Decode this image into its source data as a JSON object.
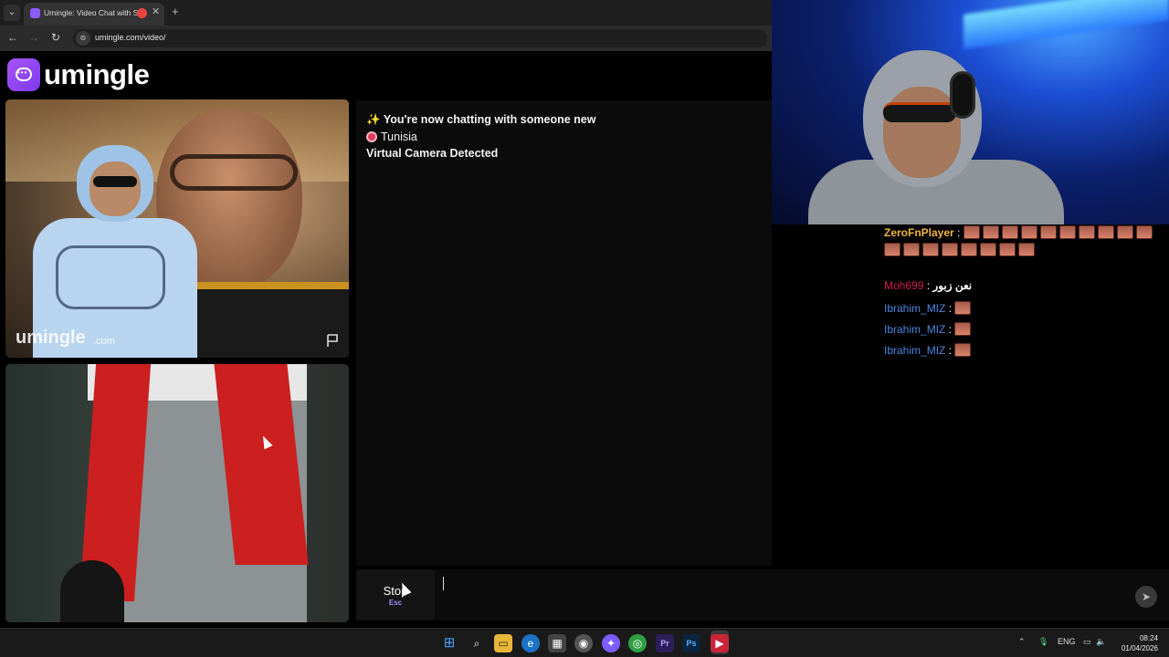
{
  "browser": {
    "tab_title": "Umingle: Video Chat with S",
    "new_tab": "+",
    "url": "umingle.com/video/"
  },
  "site": {
    "logo_text": "umingle",
    "watermark": "umingle",
    "watermark_suffix": ".com"
  },
  "chat": {
    "status_line": "You're now chatting with someone new",
    "country": "Tunisia",
    "notice": "Virtual Camera Detected"
  },
  "composer": {
    "stop_label": "Stop",
    "stop_shortcut": "Esc",
    "input_value": ""
  },
  "stream_chat": {
    "messages": [
      {
        "user": "ZeroFnPlayer",
        "sep": ":",
        "text": "",
        "emotes": 18
      },
      {
        "user": "Moh699",
        "sep": ":",
        "text": "نعن زبور",
        "emotes": 0
      },
      {
        "user": "Ibrahim_MIZ",
        "sep": ":",
        "text": "",
        "emotes": 1
      },
      {
        "user": "Ibrahim_MIZ",
        "sep": ":",
        "text": "",
        "emotes": 1
      },
      {
        "user": "Ibrahim_MIZ",
        "sep": ":",
        "text": "",
        "emotes": 1
      }
    ]
  },
  "taskbar": {
    "language": "ENG",
    "time": "08:24",
    "date": "01/04/2026"
  },
  "colors": {
    "brand": "#8b5cf6",
    "accent_key": "#a78bfa",
    "user_gold": "#f0b43c",
    "user_red": "#d11a4a",
    "user_blue": "#4c86e0"
  }
}
